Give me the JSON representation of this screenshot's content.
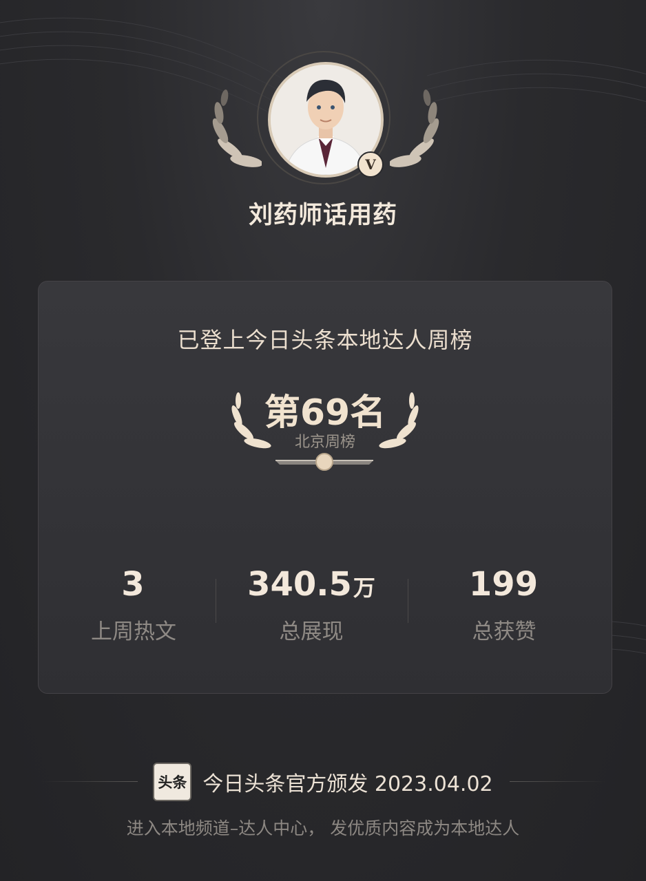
{
  "profile": {
    "name": "刘药师话用药",
    "badge": "V"
  },
  "card": {
    "title": "已登上今日头条本地达人周榜",
    "rank": "第69名",
    "rank_sub": "北京周榜",
    "stats": [
      {
        "value": "3",
        "unit": "",
        "label": "上周热文"
      },
      {
        "value": "340.5",
        "unit": "万",
        "label": "总展现"
      },
      {
        "value": "199",
        "unit": "",
        "label": "总获赞"
      }
    ]
  },
  "footer": {
    "logo_text": "头条",
    "issued": "今日头条官方颁发 2023.04.02",
    "note": "进入本地频道–达人中心， 发优质内容成为本地达人"
  },
  "colors": {
    "accent": "#f1e3cf",
    "background": "#2a2a2d",
    "card": "#333337"
  },
  "icons": [
    "laurel-icon",
    "verified-icon",
    "toutiao-logo-icon"
  ]
}
